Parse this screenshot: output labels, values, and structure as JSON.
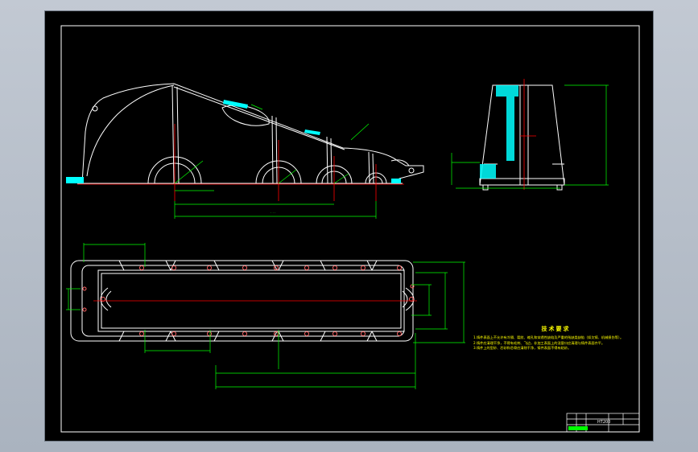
{
  "technical_requirements": {
    "title": "技术要求",
    "items": [
      "1.铸件表面上不允许有冷隔、裂纹、缩孔和穿透性缺陷及严重的残缺类缺陷（如欠铸、机械损伤等）。",
      "2.铸件应清理干净，不得有毛刺、飞边，非加工表面上的浇冒口应清理与铸件表面齐平。",
      "3.铸件上的型砂、芯砂和芯骨应清除干净，铸件表面不得有粘砂。"
    ]
  },
  "title_block": {
    "material": "HT200"
  },
  "colors": {
    "background": "#000000",
    "outline": "#ffffff",
    "dimension": "#00ff00",
    "centerline": "#ff0000",
    "hatch": "#00ffff",
    "text": "#ffff00"
  }
}
